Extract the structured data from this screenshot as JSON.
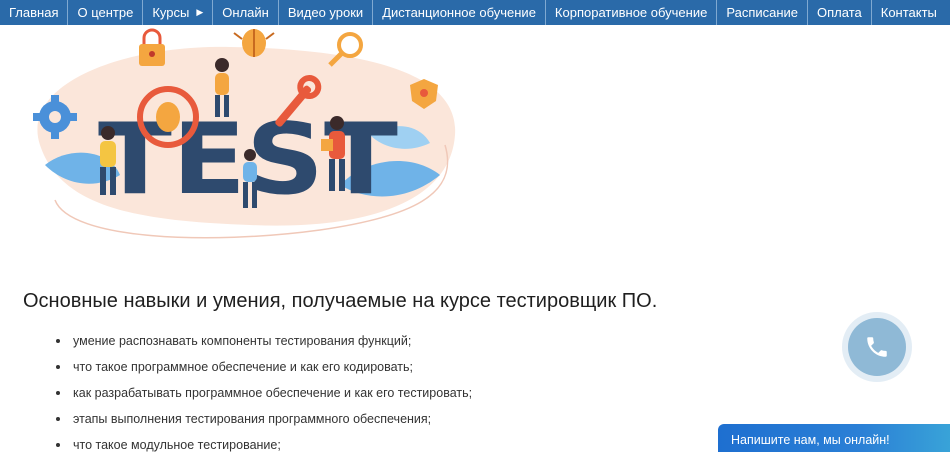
{
  "nav": {
    "items": [
      {
        "label": "Главная"
      },
      {
        "label": "О центре"
      },
      {
        "label": "Курсы"
      },
      {
        "label": "Онлайн"
      },
      {
        "label": "Видео уроки"
      },
      {
        "label": "Дистанционное обучение"
      },
      {
        "label": "Корпоративное обучение"
      },
      {
        "label": "Расписание"
      },
      {
        "label": "Оплата"
      },
      {
        "label": "Контакты"
      }
    ],
    "caret_icon": "caret-right-icon"
  },
  "hero": {
    "word": "TEST"
  },
  "content": {
    "heading": "Основные навыки и умения, получаемые на курсе тестировщик ПО.",
    "skills": [
      "умение распознавать компоненты тестирования функций;",
      "что такое программное обеспечение и как его кодировать;",
      "как разрабатывать программное обеспечение и как его тестировать;",
      "этапы выполнения тестирования программного обеспечения;",
      "что такое модульное тестирование;"
    ]
  },
  "call_button": {
    "icon": "phone-icon"
  },
  "chat": {
    "label": "Напишите нам, мы онлайн!"
  },
  "colors": {
    "nav_bg": "#2a6aa9",
    "hero_text": "#2e4a6e",
    "accent_orange": "#f4a640",
    "accent_red": "#e85a3c",
    "call_button": "#8fb9d6",
    "chat_bg": "#1e6fd0"
  }
}
